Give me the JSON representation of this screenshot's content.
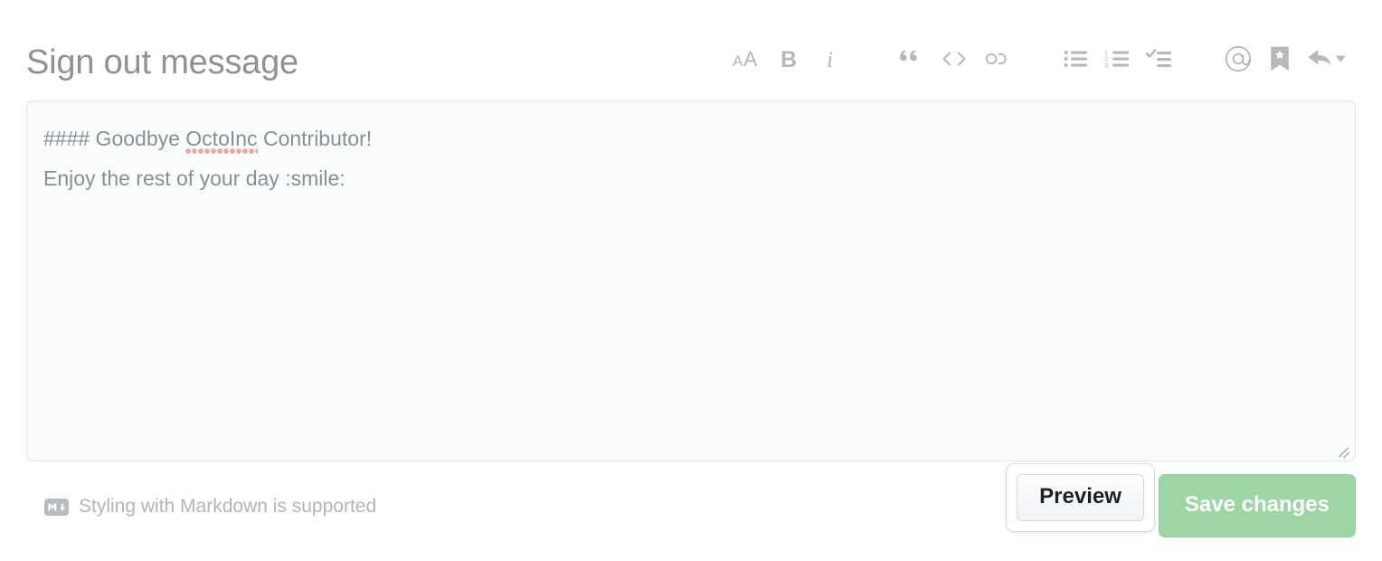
{
  "header": {
    "title": "Sign out message"
  },
  "toolbar": {
    "groups": [
      {
        "name": "text-format",
        "items": [
          {
            "id": "heading",
            "icon": "heading-aa-icon",
            "label": "Add heading text"
          },
          {
            "id": "bold",
            "icon": "bold-icon",
            "label": "Add bold text"
          },
          {
            "id": "italic",
            "icon": "italic-icon",
            "label": "Add italic text"
          }
        ]
      },
      {
        "name": "insert-block",
        "items": [
          {
            "id": "quote",
            "icon": "quote-icon",
            "label": "Add a quote"
          },
          {
            "id": "code",
            "icon": "code-icon",
            "label": "Add code"
          },
          {
            "id": "link",
            "icon": "link-icon",
            "label": "Add a link"
          }
        ]
      },
      {
        "name": "lists",
        "items": [
          {
            "id": "unordered-list",
            "icon": "unordered-list-icon",
            "label": "Add a bulleted list"
          },
          {
            "id": "ordered-list",
            "icon": "ordered-list-icon",
            "label": "Add a numbered list"
          },
          {
            "id": "task-list",
            "icon": "task-list-icon",
            "label": "Add a task list"
          }
        ]
      },
      {
        "name": "extras",
        "items": [
          {
            "id": "mention",
            "icon": "mention-at-icon",
            "label": "Directly mention a user or team"
          },
          {
            "id": "saved-replies",
            "icon": "bookmark-star-icon",
            "label": "Reference an issue, pull request, or discussion"
          },
          {
            "id": "reply",
            "icon": "reply-arrow-icon",
            "label": "Add saved reply"
          }
        ]
      }
    ]
  },
  "editor": {
    "name": "sign-out-message-textarea",
    "line1_prefix": "#### Goodbye ",
    "line1_misspelled": "OctoInc",
    "line1_suffix": " Contributor!",
    "line2": "Enjoy the rest of your day :smile:",
    "value": "#### Goodbye OctoInc Contributor!\nEnjoy the rest of your day :smile:",
    "placeholder": ""
  },
  "footer": {
    "markdown_hint": "Styling with Markdown is supported",
    "markdown_badge": "markdown-icon",
    "preview_label": "Preview",
    "save_label": "Save changes"
  },
  "colors": {
    "title": "#8e9296",
    "toolbar_icon": "#b4b9be",
    "editor_text": "#8a8f94",
    "editor_bg": "#fbfcfc",
    "editor_border": "#e3e6e8",
    "hint_text": "#b0b5ba",
    "save_bg": "#9ed5a4",
    "preview_text": "#1d2125",
    "spellcheck": "#f0a39c"
  }
}
